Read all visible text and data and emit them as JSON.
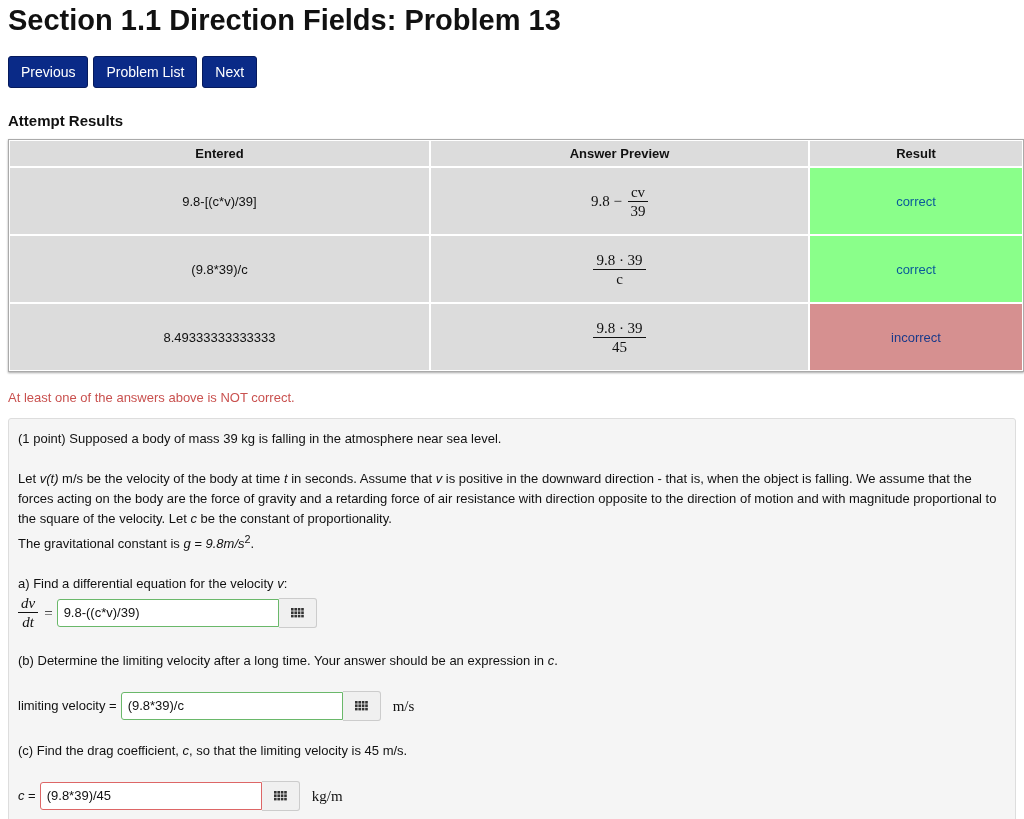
{
  "title": "Section 1.1 Direction Fields: Problem 13",
  "nav_buttons": [
    "Previous",
    "Problem List",
    "Next"
  ],
  "results_heading": "Attempt Results",
  "table": {
    "columns": [
      "Entered",
      "Answer Preview",
      "Result"
    ],
    "rows": [
      {
        "entered": "9.8-[(c*v)/39]",
        "preview": {
          "prefix": "9.8 −",
          "numerator": "cv",
          "denominator": "39"
        },
        "result": "correct",
        "correct": true
      },
      {
        "entered": "(9.8*39)/c",
        "preview": {
          "numerator": "9.8 · 39",
          "denominator": "c"
        },
        "result": "correct",
        "correct": true
      },
      {
        "entered": "8.49333333333333",
        "preview": {
          "numerator": "9.8 · 39",
          "denominator": "45"
        },
        "result": "incorrect",
        "correct": false
      }
    ]
  },
  "message": "At least one of the answers above is NOT correct.",
  "problem": {
    "intro": "(1 point) Supposed a body of mass 39 kg is falling in the atmosphere near sea level.",
    "paragraph": "Let *v(t)* m/s be the velocity of the body at time *t* in seconds. Assume that *v* is positive in the downward direction - that is, when the object is falling. We assume that the forces acting on the body are the force of gravity and a retarding force of air resistance with direction opposite to the direction of motion and with magnitude proportional to the square of the velocity. Let *c* be the constant of proportionality.",
    "constant": "The gravitational constant is *g = 9.8m/s*$^{2}$.",
    "parts": [
      {
        "question": "a) Find a differential equation for the velocity *v*:",
        "label": {
          "kind": "fraction",
          "numerator": "dv",
          "denominator": "dt",
          "suffix": "="
        },
        "value": "9.8-((c*v)/39)",
        "correct": true
      },
      {
        "question": "(b) Determine the limiting velocity after a long time. Your answer should be an expression in *c*.",
        "label": {
          "kind": "text",
          "text": "limiting velocity ="
        },
        "value": "(9.8*39)/c",
        "correct": true,
        "unit": "m/s"
      },
      {
        "question": "(c) Find the drag coefficient, *c*, so that the limiting velocity is 45 m/s.",
        "label": {
          "kind": "text",
          "text": "*c* ="
        },
        "value": "(9.8*39)/45",
        "correct": false,
        "unit": "kg/m"
      }
    ]
  }
}
